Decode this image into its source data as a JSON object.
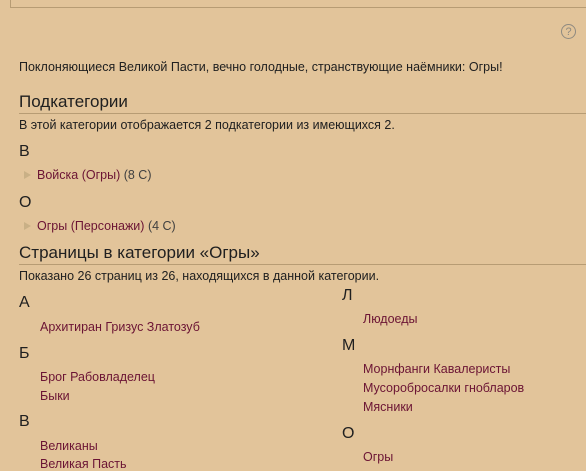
{
  "help_icon_glyph": "?",
  "intro": "Поклоняющиеся Великой Пасти, вечно голодные, странствующие наёмники: Огры!",
  "subcategories": {
    "heading": "Подкатегории",
    "info": "В этой категории отображается 2 подкатегории из имеющихся 2.",
    "groups": [
      {
        "letter": "В",
        "label": "Войска (Огры)",
        "count": "(8 С)"
      },
      {
        "letter": "О",
        "label": "Огры (Персонажи)",
        "count": "(4 С)"
      }
    ]
  },
  "pages": {
    "heading": "Страницы в категории «Огры»",
    "info": "Показано 26 страниц из 26, находящихся в данной категории.",
    "left": [
      {
        "letter": "А",
        "items": [
          "Архитиран Гризус Златозуб"
        ]
      },
      {
        "letter": "Б",
        "items": [
          "Брог Рабовладелец",
          "Быки"
        ]
      },
      {
        "letter": "В",
        "items": [
          "Великаны",
          "Великая Пасть"
        ]
      }
    ],
    "right": [
      {
        "letter": "Л",
        "items": [
          "Людоеды"
        ]
      },
      {
        "letter": "М",
        "items": [
          "Морнфанги Кавалеристы",
          "Мусоробросалки гнобларов",
          "Мясники"
        ]
      },
      {
        "letter": "О",
        "items": [
          "Огры"
        ]
      }
    ]
  },
  "colors": {
    "background": "#e2c49a",
    "link": "#6b1434",
    "rule": "#b79c74"
  }
}
